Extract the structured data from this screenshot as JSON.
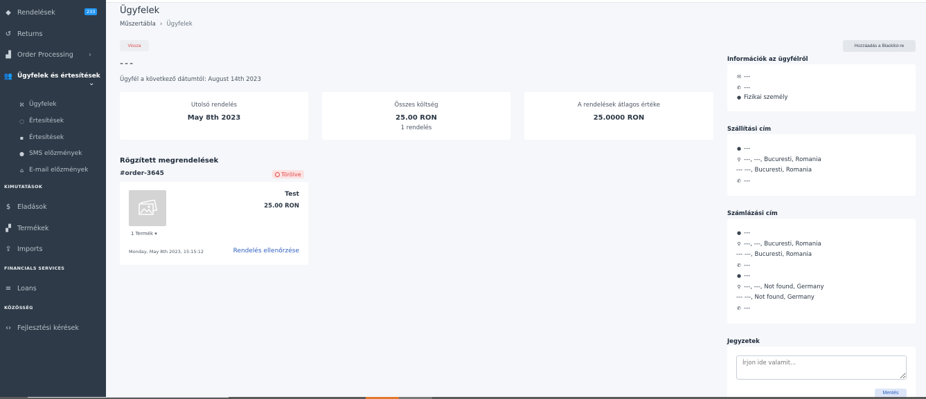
{
  "sidebar": {
    "items": [
      {
        "label": "Rendelések",
        "icon": "tag-icon",
        "badge": "233"
      },
      {
        "label": "Returns",
        "icon": "undo-icon"
      },
      {
        "label": "Order Processing",
        "icon": "forklift-icon",
        "arrow": "›"
      },
      {
        "label": "Ügyfelek és értesítések",
        "icon": "users-icon",
        "arrow": "⌄"
      }
    ],
    "sub_items": [
      {
        "label": "Ügyfelek",
        "icon": "users-outline-icon"
      },
      {
        "label": "Értesítések",
        "icon": "chat-icon"
      },
      {
        "label": "Értesítések",
        "icon": "document-icon"
      },
      {
        "label": "SMS előzmények",
        "icon": "sms-icon"
      },
      {
        "label": "E-mail előzmények",
        "icon": "inbox-icon"
      }
    ],
    "section_reports": "KIMUTATÁSOK",
    "report_items": [
      {
        "label": "Eladások",
        "icon": "dollar-icon"
      },
      {
        "label": "Termékek",
        "icon": "boxes-icon"
      },
      {
        "label": "Imports",
        "icon": "upload-icon"
      }
    ],
    "section_financials": "FINANCIALS SERVICES",
    "financial_items": [
      {
        "label": "Loans",
        "icon": "coins-icon"
      }
    ],
    "section_community": "KÖZÖSSÉG",
    "community_items": [
      {
        "label": "Fejlesztési kérések",
        "icon": "code-icon"
      }
    ]
  },
  "header": {
    "title": "Ügyfelek",
    "breadcrumb": {
      "root": "Műszertábla",
      "separator": "›",
      "current": "Ügyfelek"
    }
  },
  "actions": {
    "back": "Vissza",
    "blacklist": "Hozzáadás a Blacklist-re"
  },
  "customer": {
    "name": "---",
    "since": "Ügyfél a következő dátumtól: August 14th 2023"
  },
  "stats": [
    {
      "title": "Utolsó rendelés",
      "value": "May 8th 2023",
      "sub": ""
    },
    {
      "title": "Összes költség",
      "value": "25.00 RON",
      "sub": "1 rendelés"
    },
    {
      "title": "A rendelések átlagos értéke",
      "value": "25.0000 RON",
      "sub": ""
    }
  ],
  "orders": {
    "title": "Rögzített megrendelések",
    "items": [
      {
        "id": "#order-3645",
        "status": "Törölve",
        "product_name": "Test",
        "product_price": "25.00 RON",
        "product_count": "1 Termék ▾",
        "date": "Monday, May 8th 2023, 15:15:12",
        "link": "Rendelés ellenőrzése"
      }
    ]
  },
  "info": {
    "title": "Információk az ügyfélről",
    "email": "---",
    "phone": "---",
    "type": "Fizikai személy"
  },
  "shipping": {
    "title": "Szállítási cím",
    "name": "---",
    "address": "---, ---, Bucuresti, Romania",
    "address2": "--- ---, Bucuresti, Romania",
    "phone": "---"
  },
  "billing": {
    "title": "Számlázási cím",
    "name": "---",
    "address": "---, ---, Bucuresti, Romania",
    "address2": "--- ---, Bucuresti, Romania",
    "phone": "---",
    "name_b": "---",
    "address_b": "---, ---, Not found, Germany",
    "address2_b": "--- ---, Not found, Germany",
    "phone_b": "---"
  },
  "notes": {
    "title": "Jegyzetek",
    "placeholder": "Írjon ide valamit...",
    "save": "Mentés"
  }
}
